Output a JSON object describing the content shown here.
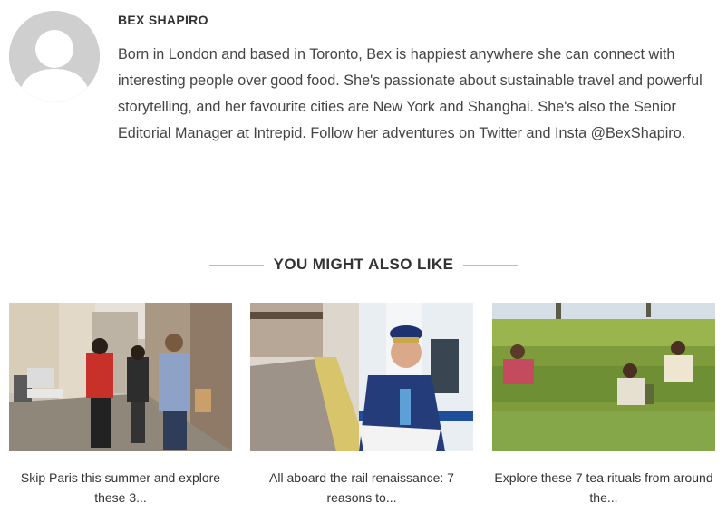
{
  "author": {
    "name": "BEX SHAPIRO",
    "bio": "Born in London and based in Toronto, Bex is happiest anywhere she can connect with interesting people over good food. She's passionate about sustainable travel and powerful storytelling, and her favourite cities are New York and Shanghai. She's also the Senior Editorial Manager at Intrepid. Follow her adventures on Twitter and Insta @BexShapiro."
  },
  "related": {
    "heading": "YOU MIGHT ALSO LIKE",
    "cards": [
      {
        "title": "Skip Paris this summer and explore these 3..."
      },
      {
        "title": "All aboard the rail renaissance: 7 reasons to..."
      },
      {
        "title": "Explore these 7 tea rituals from around the..."
      }
    ]
  }
}
